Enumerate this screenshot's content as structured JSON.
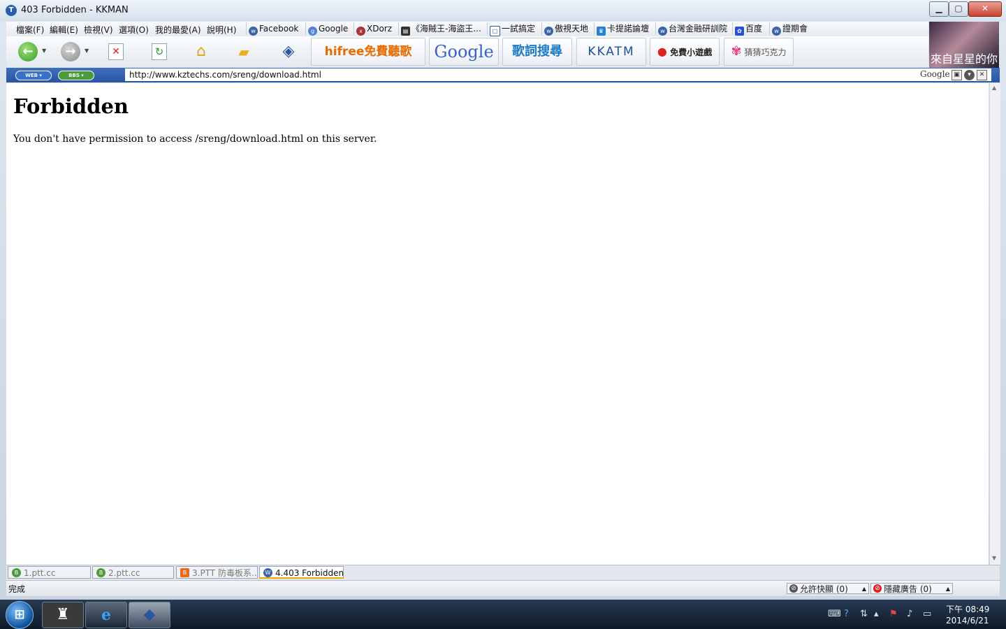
{
  "window": {
    "title": "403 Forbidden - KKMAN",
    "app_icon_glyph": "T"
  },
  "menu": [
    "檔案(F)",
    "編輯(E)",
    "檢視(V)",
    "選項(O)",
    "我的最愛(A)",
    "說明(H)"
  ],
  "favorites": [
    {
      "label": "Facebook",
      "icon": "w"
    },
    {
      "label": "Google",
      "icon": "g"
    },
    {
      "label": "XDorz",
      "icon": "x"
    },
    {
      "label": "《海賊王-海盜王...",
      "icon": "film"
    },
    {
      "label": "一試搞定",
      "icon": "box"
    },
    {
      "label": "傲視天地",
      "icon": "w"
    },
    {
      "label": "卡提諾論壇",
      "icon": "crown"
    },
    {
      "label": "台灣金融研訓院",
      "icon": "w"
    },
    {
      "label": "百度",
      "icon": "paw"
    },
    {
      "label": "證期會",
      "icon": "w"
    }
  ],
  "toolbar_banners": [
    {
      "label": "hifree免費聽歌",
      "color": "#e86a00"
    },
    {
      "label": "Google",
      "color": "#3a62c4"
    },
    {
      "label": "歌詞搜尋",
      "color": "#1e7bc4"
    },
    {
      "label": "KKATM",
      "color": "#1d4f9a"
    },
    {
      "label": "免費小遊戲",
      "color": "#222222"
    },
    {
      "label": "猜猜巧克力",
      "color": "#555555"
    }
  ],
  "ad_image_caption": "來自星星的你",
  "address": {
    "web_label": "WEB ▾",
    "bbs_label": "BBS ▾",
    "url": "http://www.kztechs.com/sreng/download.html",
    "search_engine": "Google"
  },
  "page": {
    "heading": "Forbidden",
    "message": "You don't have permission to access /sreng/download.html on this server."
  },
  "tabs": [
    {
      "label": "1.ptt.cc",
      "icon": "B",
      "color": "#4a9a3a"
    },
    {
      "label": "2.ptt.cc",
      "icon": "B",
      "color": "#4a9a3a"
    },
    {
      "label": "3.PTT 防毒板系...",
      "icon": "B",
      "color": "#e86a1a"
    },
    {
      "label": "4.403 Forbidden",
      "icon": "W",
      "color": "#3b64a8"
    }
  ],
  "status": {
    "text": "完成",
    "popup_allowed": "允許快顯 (0)",
    "ads_blocked": "隱藏廣告 (0)"
  },
  "taskbar": {
    "time": "下午 08:49",
    "date": "2014/6/21"
  }
}
